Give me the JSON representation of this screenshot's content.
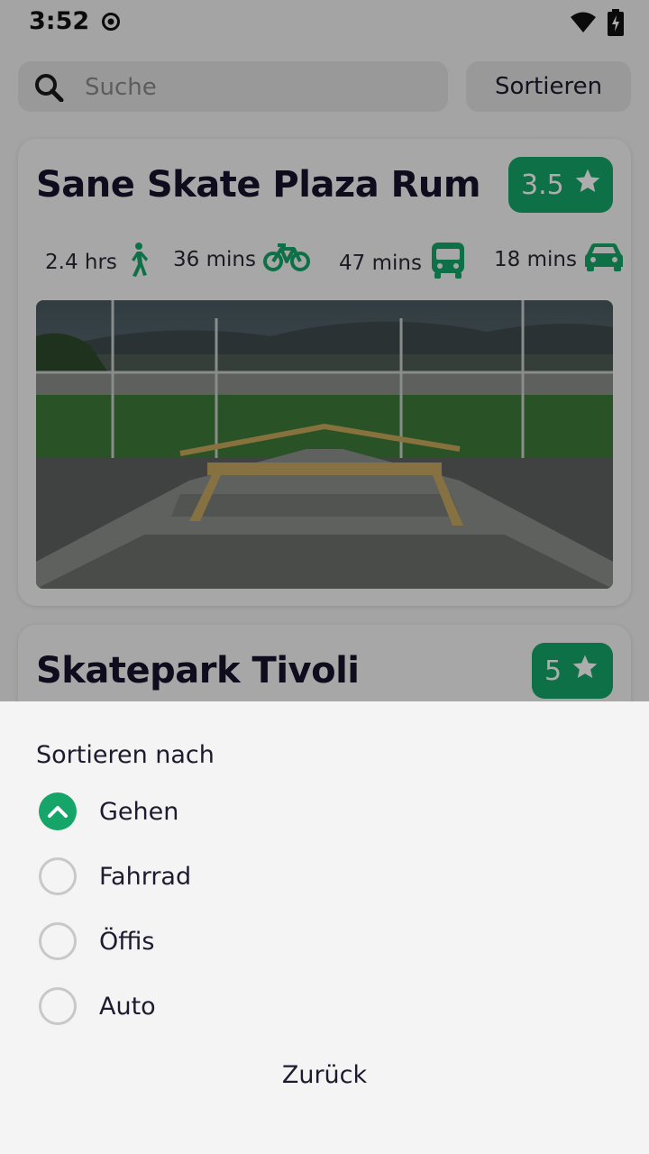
{
  "status_bar": {
    "time": "3:52"
  },
  "search": {
    "placeholder": "Suche",
    "value": ""
  },
  "sort_button_label": "Sortieren",
  "cards": [
    {
      "title": "Sane Skate Plaza Rum",
      "rating": "3.5",
      "travel": {
        "walk": "2.4 hrs",
        "bike": "36 mins",
        "transit": "47 mins",
        "car": "18 mins"
      }
    },
    {
      "title": "Skatepark Tivoli",
      "rating": "5"
    }
  ],
  "sort_sheet": {
    "title": "Sortieren nach",
    "options": [
      {
        "label": "Gehen",
        "selected": true
      },
      {
        "label": "Fahrrad",
        "selected": false
      },
      {
        "label": "Öffis",
        "selected": false
      },
      {
        "label": "Auto",
        "selected": false
      }
    ],
    "back_label": "Zurück"
  },
  "colors": {
    "accent": "#15a569",
    "title_text": "#15122b",
    "background": "#f2f2f2"
  }
}
